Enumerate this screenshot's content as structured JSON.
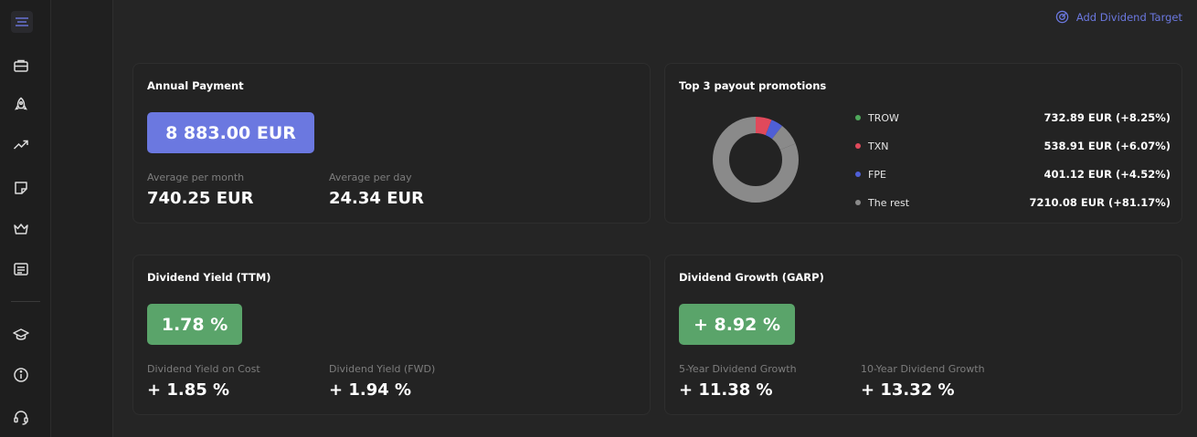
{
  "topbar": {
    "add_target_label": "Add Dividend Target"
  },
  "sidebar": {
    "items": [
      {
        "icon": "briefcase-icon"
      },
      {
        "icon": "rocket-icon"
      },
      {
        "icon": "trending-up-icon"
      },
      {
        "icon": "sticker-icon"
      },
      {
        "icon": "crown-icon"
      },
      {
        "icon": "news-icon"
      },
      {
        "icon": "graduation-cap-icon"
      },
      {
        "icon": "info-icon"
      },
      {
        "icon": "headset-icon"
      }
    ]
  },
  "annual_payment": {
    "title": "Annual Payment",
    "total": "8 883.00 EUR",
    "avg_month_label": "Average per month",
    "avg_month_value": "740.25 EUR",
    "avg_day_label": "Average per day",
    "avg_day_value": "24.34 EUR",
    "badge_color": "#6b78e0"
  },
  "top_payouts": {
    "title": "Top 3 payout promotions",
    "items": [
      {
        "name": "TROW",
        "value": "732.89 EUR (+8.25%)",
        "share": 8.25,
        "color": "#4fa85b"
      },
      {
        "name": "TXN",
        "value": "538.91 EUR (+6.07%)",
        "share": 6.07,
        "color": "#e0495b"
      },
      {
        "name": "FPE",
        "value": "401.12 EUR (+4.52%)",
        "share": 4.52,
        "color": "#4f5fd6"
      },
      {
        "name": "The rest",
        "value": "7210.08 EUR (+81.17%)",
        "share": 81.17,
        "color": "#8a8a8a"
      }
    ]
  },
  "dividend_yield": {
    "title": "Dividend Yield (TTM)",
    "value": "1.78 %",
    "on_cost_label": "Dividend Yield on Cost",
    "on_cost_value": "+ 1.85 %",
    "fwd_label": "Dividend Yield (FWD)",
    "fwd_value": "+ 1.94 %",
    "badge_color": "#5aa46a"
  },
  "dividend_growth": {
    "title": "Dividend Growth (GARP)",
    "value": "+ 8.92 %",
    "five_year_label": "5-Year Dividend Growth",
    "five_year_value": "+ 11.38 %",
    "ten_year_label": "10-Year Dividend Growth",
    "ten_year_value": "+ 13.32 %",
    "badge_color": "#5aa46a"
  }
}
